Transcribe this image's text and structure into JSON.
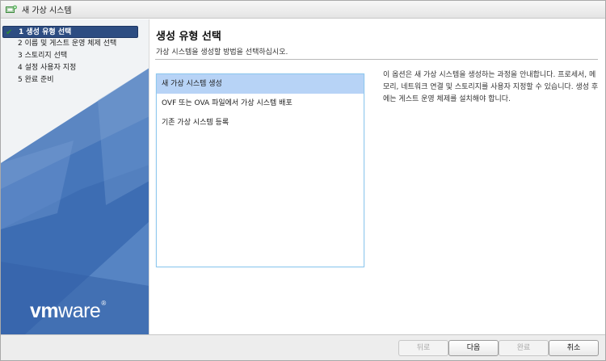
{
  "window": {
    "title": "새 가상 시스템"
  },
  "sidebar": {
    "steps": [
      {
        "label": "1 생성 유형 선택",
        "state": "active",
        "completed": true
      },
      {
        "label": "2 이름 및 게스트 운영 체제 선택",
        "state": "pending"
      },
      {
        "label": "3 스토리지 선택",
        "state": "pending"
      },
      {
        "label": "4 설정 사용자 지정",
        "state": "pending"
      },
      {
        "label": "5 완료 준비",
        "state": "pending"
      }
    ],
    "logo": {
      "vm": "vm",
      "ware": "ware",
      "reg": "®"
    }
  },
  "content": {
    "title": "생성 유형 선택",
    "subtitle": "가상 시스템을 생성할 방법을 선택하십시오.",
    "options": [
      {
        "label": "새 가상 시스템 생성",
        "selected": true
      },
      {
        "label": "OVF 또는 OVA 파일에서 가상 시스템 배포",
        "selected": false
      },
      {
        "label": "기존 가상 시스템 등록",
        "selected": false
      }
    ],
    "description": "이 옵션은 새 가상 시스템을 생성하는 과정을 안내합니다. 프로세서, 메모리, 네트워크 연결 및 스토리지를 사용자 지정할 수 있습니다. 생성 후에는 게스트 운영 체제를 설치해야 합니다."
  },
  "footer": {
    "back_label": "뒤로",
    "next_label": "다음",
    "finish_label": "완료",
    "cancel_label": "취소"
  },
  "colors": {
    "accent": "#2d4d82",
    "selection": "#b7d3f6",
    "listbox_border": "#8fc8ee",
    "logo_blue": "#3b6bb3"
  }
}
